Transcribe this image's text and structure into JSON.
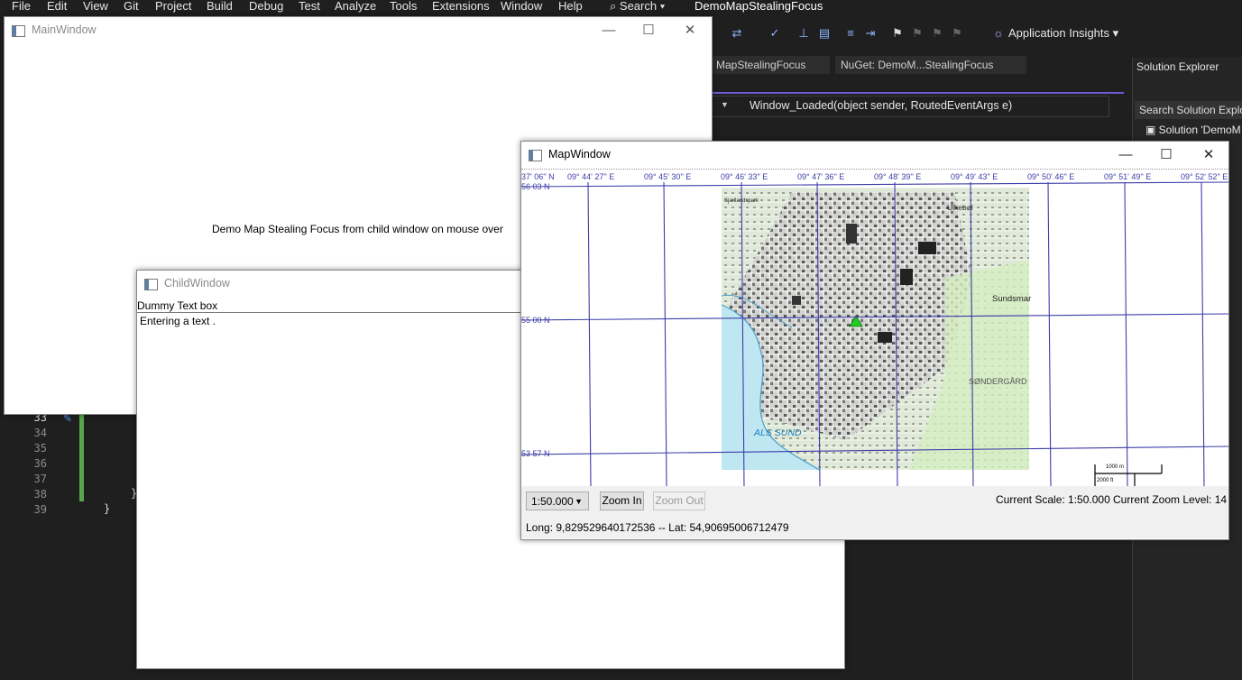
{
  "vs": {
    "menu": [
      "File",
      "Edit",
      "View",
      "Git",
      "Project",
      "Build",
      "Debug",
      "Test",
      "Analyze",
      "Tools",
      "Extensions",
      "Window",
      "Help"
    ],
    "search_label": "Search",
    "solution_title": "DemoMapStealingFocus",
    "toolbar": {
      "app_insights": "Application Insights"
    },
    "tabs": [
      "MapStealingFocus",
      "NuGet: DemoM...StealingFocus"
    ],
    "nav_method": "Window_Loaded(object sender, RoutedEventArgs e)",
    "solution_explorer": {
      "title": "Solution Explorer",
      "search_placeholder": "Search Solution Explo",
      "root": "Solution 'DemoM"
    },
    "line_numbers": [
      "33",
      "34",
      "35",
      "36",
      "37",
      "38",
      "39"
    ],
    "code_fragments": [
      "}",
      "}"
    ]
  },
  "main_window": {
    "title": "MainWindow",
    "text": "Demo Map Stealing Focus from child window on mouse over"
  },
  "child_window": {
    "title": "ChildWindow",
    "label": "Dummy Text box",
    "input_value": "Entering a text ."
  },
  "map_window": {
    "title": "MapWindow",
    "longitude_labels": [
      "37' 06'' N",
      "09° 44' 27'' E",
      "09° 45' 30'' E",
      "09° 46' 33'' E",
      "09° 47' 36'' E",
      "09° 48' 39'' E",
      "09° 49' 43'' E",
      "09° 50' 46'' E",
      "09° 51' 49'' E",
      "09° 52' 52'' E"
    ],
    "latitude_labels": [
      "56 03 N",
      "55 00 N",
      "53 57 N"
    ],
    "place_labels": [
      "ALS SUND",
      "SØNDERGÅRD",
      "Sundsmar",
      "Ulkebøl",
      "Sjællandspark"
    ],
    "scale_bar": {
      "upper": "1000 m",
      "lower": "2000 ft"
    },
    "scale_options_selected": "1:50.000",
    "zoom_in_label": "Zoom In",
    "zoom_out_label": "Zoom Out",
    "current_scale": "Current Scale: 1:50.000",
    "current_zoom": "Current Zoom Level: 14",
    "coordinates": "Long: 9,829529640172536 -- Lat: 54,90695006712479",
    "colors": {
      "grid": "#3d3da8",
      "water": "#bfe7f2",
      "land_green": "#d4eec1",
      "marker": "#22cc22"
    }
  }
}
